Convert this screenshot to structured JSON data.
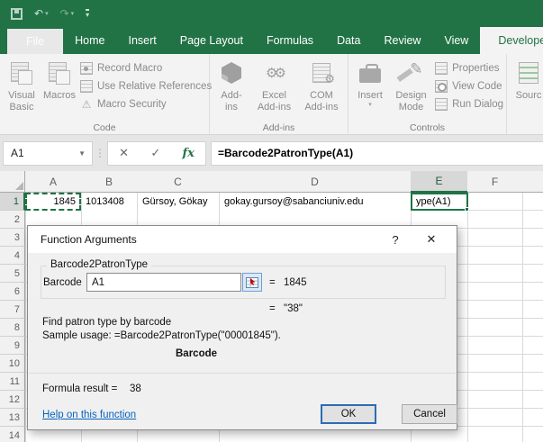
{
  "icons": {
    "undo": "↶",
    "redo": "↷",
    "dropdown": "▾",
    "name_box_dropdown": "▼",
    "vertical_dots": "⋮",
    "cancel": "✕",
    "confirm": "✓",
    "warning": "⚠",
    "gears": "⚙⚙",
    "gear": "⚙",
    "pencil": "✎",
    "help": "?",
    "close": "✕"
  },
  "ribbon": {
    "tabs": [
      "File",
      "Home",
      "Insert",
      "Page Layout",
      "Formulas",
      "Data",
      "Review",
      "View",
      "Developer"
    ],
    "active_tab": "Developer",
    "groups": {
      "code": "Code",
      "add_ins": "Add-ins",
      "controls": "Controls"
    },
    "buttons": {
      "visual_basic": "Visual Basic",
      "macros": "Macros",
      "record_macro": "Record Macro",
      "use_relative_references": "Use Relative References",
      "macro_security": "Macro Security",
      "add_ins": "Add-ins",
      "excel_add_ins": "Excel Add-ins",
      "com_add_ins": "COM Add-ins",
      "insert": "Insert",
      "design_mode": "Design Mode",
      "properties": "Properties",
      "view_code": "View Code",
      "run_dialog": "Run Dialog",
      "source": "Sourc"
    }
  },
  "formula_bar": {
    "name_box": "A1",
    "fx_label": "fx",
    "formula": "=Barcode2PatronType(A1)"
  },
  "grid": {
    "columns": [
      "A",
      "B",
      "C",
      "D",
      "E",
      "F"
    ],
    "rows": [
      "1",
      "2",
      "3",
      "4",
      "5",
      "6",
      "7",
      "8",
      "9",
      "10",
      "11",
      "12",
      "13",
      "14"
    ],
    "active_cell": "E1",
    "cells": {
      "a1": "1845",
      "b1": "1013408",
      "c1": "Gürsoy, Gökay",
      "d1": "gokay.gursoy@sabanciuniv.edu",
      "e1": "ype(A1)"
    }
  },
  "dialog": {
    "title": "Function Arguments",
    "function_group": "Barcode2PatronType",
    "arg_label": "Barcode",
    "arg_value": "A1",
    "equals": "=",
    "arg_result": "1845",
    "return_result": "\"38\"",
    "description": "Find patron type by barcode",
    "sample_usage": "Sample usage: =Barcode2PatronType(\"00001845\").",
    "arg_name": "Barcode",
    "formula_result_label": "Formula result =",
    "formula_result_value": "38",
    "help_link": "Help on this function",
    "ok_label": "OK",
    "cancel_label": "Cancel"
  },
  "colors": {
    "excel_green": "#217346",
    "link_blue": "#0563c1",
    "ok_border_blue": "#2d6bb5",
    "grid_line": "#d9d9d9"
  }
}
